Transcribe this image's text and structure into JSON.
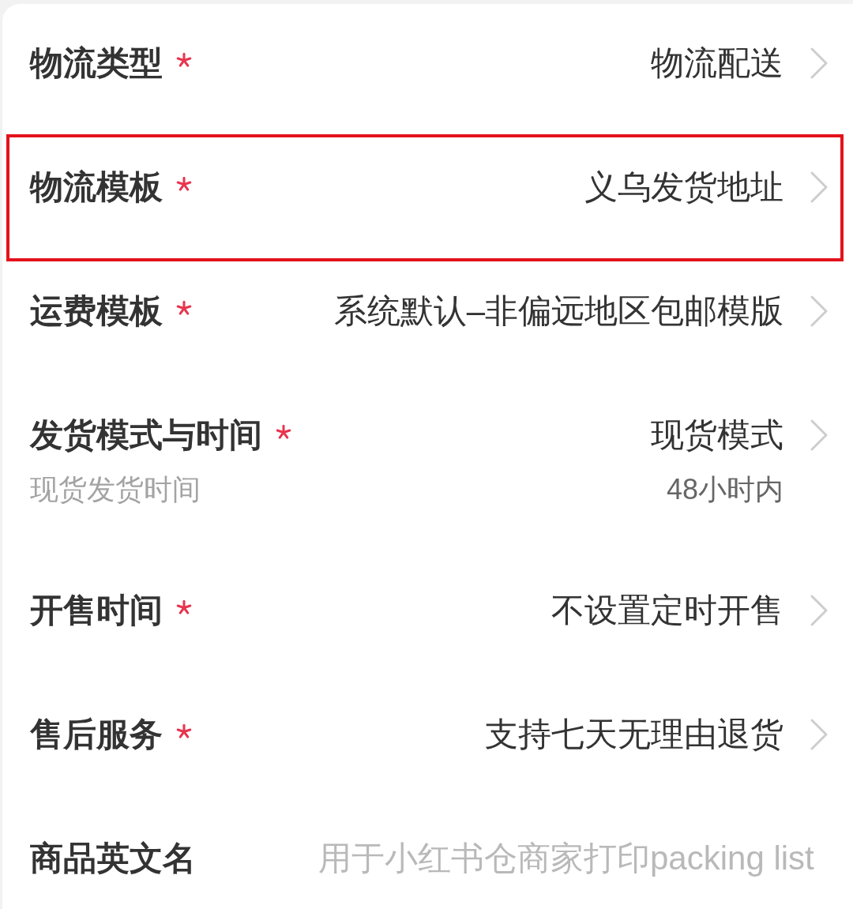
{
  "rows": [
    {
      "kind": "select",
      "label": "物流类型",
      "required": true,
      "highlighted": false,
      "value": "物流配送"
    },
    {
      "kind": "select",
      "label": "物流模板",
      "required": true,
      "highlighted": true,
      "value": "义乌发货地址"
    },
    {
      "kind": "select",
      "label": "运费模板",
      "required": true,
      "highlighted": false,
      "value": "系统默认–非偏远地区包邮模版"
    },
    {
      "kind": "select",
      "label": "发货模式与时间",
      "required": true,
      "highlighted": false,
      "value": "现货模式",
      "hint": "现货发货时间",
      "detail": "48小时内"
    },
    {
      "kind": "select",
      "label": "开售时间",
      "required": true,
      "highlighted": false,
      "value": "不设置定时开售"
    },
    {
      "kind": "select",
      "label": "售后服务",
      "required": true,
      "highlighted": false,
      "value": "支持七天无理由退货"
    },
    {
      "kind": "input",
      "label": "商品英文名",
      "required": false,
      "highlighted": false,
      "placeholder": "用于小红书仓商家打印packing list"
    }
  ]
}
